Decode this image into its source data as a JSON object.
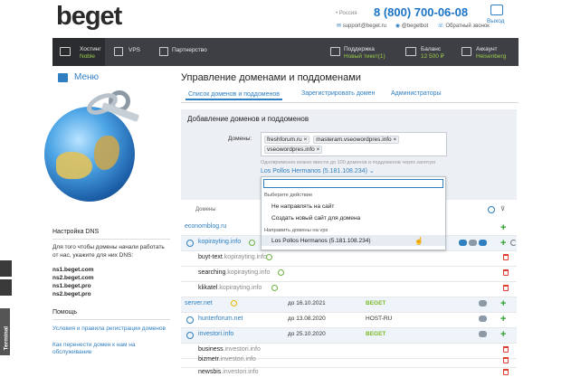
{
  "header": {
    "logo_text": "beget",
    "region": "• Россия",
    "phone": "8 (800) 700-06-08",
    "exit_label": "Выход",
    "contacts": [
      "support@beget.ru",
      "@begetbot",
      "Обратный звонок"
    ]
  },
  "nav": {
    "items": [
      {
        "label": "Хостинг",
        "sub": "Noble"
      },
      {
        "label": "VPS",
        "sub": ""
      },
      {
        "label": "Партнерство",
        "sub": ""
      },
      {
        "label": "Поддержка",
        "sub": "Новый тикет(1)"
      },
      {
        "label": "Баланс",
        "sub": "12 500 ₽"
      },
      {
        "label": "Аккаунт",
        "sub": "Heisenberg"
      }
    ]
  },
  "sidebar": {
    "menu_label": "Меню",
    "dns_title": "Настройка DNS",
    "dns_text": "Для того чтобы домены начали работать от нас, укажите для них DNS:",
    "ns": [
      "ns1.beget.com",
      "ns2.beget.com",
      "ns1.beget.pro",
      "ns2.beget.pro"
    ],
    "help_title": "Помощь",
    "help_links": [
      "Условия и правила регистрации доменов",
      "Как перенести домен к нам на обслуживание"
    ],
    "terminal_label": "Terminal"
  },
  "main": {
    "title": "Управление доменами и поддоменами",
    "tabs": [
      "Список доменов и поддоменов",
      "Зарегистрировать домен",
      "Администраторы"
    ],
    "add_panel": {
      "title": "Добавление доменов и поддоменов",
      "domains_label": "Домены:",
      "tags": [
        "freshforum.ru",
        "masteram.vseowordpres.info",
        "vseowordpres.info"
      ],
      "hint": "Одновременно можно ввести до 100 доменов и поддоменов через запятую",
      "selected_site": "Los Pollos Hermanos (5.181.108.234)"
    },
    "dropdown": {
      "group1": "Выберите действие",
      "items1": [
        "Не направлять на сайт",
        "Создать новый сайт для домена"
      ],
      "group2": "Направить домены на vps",
      "items2": [
        "Los Pollos Hermanos (5.181.108.234)"
      ]
    },
    "table": {
      "col_domains": "Домены",
      "rows": [
        {
          "name": "economblog.ru",
          "date": "",
          "ns": "",
          "level": 0
        },
        {
          "name": "kopirayting.info",
          "date": "",
          "ns": "",
          "level": 0
        },
        {
          "sub": "buyt-text",
          "parent": ".kopirayting.info",
          "level": 1
        },
        {
          "sub": "searching",
          "parent": ".kopirayting.info",
          "level": 1
        },
        {
          "sub": "klikatel",
          "parent": ".kopirayting.info",
          "level": 1
        },
        {
          "name": "server.net",
          "date": "до 16.10.2021",
          "ns": "BEGET",
          "level": 0
        },
        {
          "name": "hunterforum.net",
          "date": "до 13.08.2020",
          "ns": "HOST-RU",
          "level": 0
        },
        {
          "name": "investori.info",
          "date": "до 25.10.2020",
          "ns": "BEGET",
          "level": 0
        },
        {
          "sub": "business",
          "parent": ".investori.info",
          "level": 1
        },
        {
          "sub": "bizmetr",
          "parent": ".investori.info",
          "level": 1
        },
        {
          "sub": "newsbis",
          "parent": ".investori.info",
          "level": 1
        }
      ]
    }
  },
  "colors": {
    "accent": "#2f7fc1",
    "nav_bg": "#3d3f45",
    "green": "#7cb82a",
    "red": "#e03c31"
  }
}
